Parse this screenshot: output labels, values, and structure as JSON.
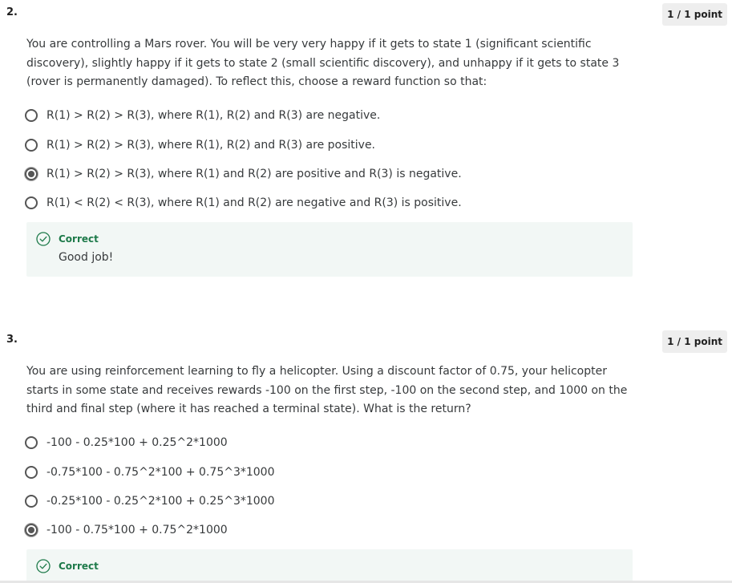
{
  "questions": [
    {
      "number": "2.",
      "points": "1 / 1 point",
      "prompt": "You are controlling a Mars rover. You will be very very happy if it gets to state 1 (significant scientific discovery), slightly happy if it gets to state 2 (small scientific discovery), and unhappy if it gets to state 3 (rover is permanently damaged). To reflect this, choose a reward function so that:",
      "options": [
        {
          "label": "R(1) > R(2) > R(3), where R(1), R(2) and R(3) are negative.",
          "selected": false
        },
        {
          "label": "R(1) > R(2) > R(3), where R(1), R(2) and R(3) are positive.",
          "selected": false
        },
        {
          "label": "R(1) > R(2) > R(3), where R(1) and R(2) are positive and R(3) is negative.",
          "selected": true
        },
        {
          "label": "R(1) < R(2) < R(3), where R(1) and R(2) are negative and R(3) is positive.",
          "selected": false
        }
      ],
      "feedback": {
        "title": "Correct",
        "text": "Good job!"
      }
    },
    {
      "number": "3.",
      "points": "1 / 1 point",
      "prompt": "You are using reinforcement learning to fly a helicopter. Using a discount factor of 0.75, your helicopter starts in some state and receives rewards -100 on the first step, -100 on the second step, and 1000 on the third and final step (where it has reached a terminal state). What is the return?",
      "options": [
        {
          "label": "-100 - 0.25*100 + 0.25^2*1000",
          "selected": false
        },
        {
          "label": "-0.75*100 - 0.75^2*100 + 0.75^3*1000",
          "selected": false
        },
        {
          "label": "-0.25*100 - 0.25^2*100 + 0.25^3*1000",
          "selected": false
        },
        {
          "label": "-100 - 0.75*100 + 0.75^2*1000",
          "selected": true
        }
      ],
      "feedback": {
        "title": "Correct"
      }
    }
  ],
  "colors": {
    "correct": "#1e7a4a",
    "feedback_bg": "#f2f7f5",
    "badge_bg": "#eeeeee"
  },
  "icons": {
    "feedback": "check-circle-icon",
    "option_unselected": "radio-empty-icon",
    "option_selected": "radio-filled-icon"
  }
}
